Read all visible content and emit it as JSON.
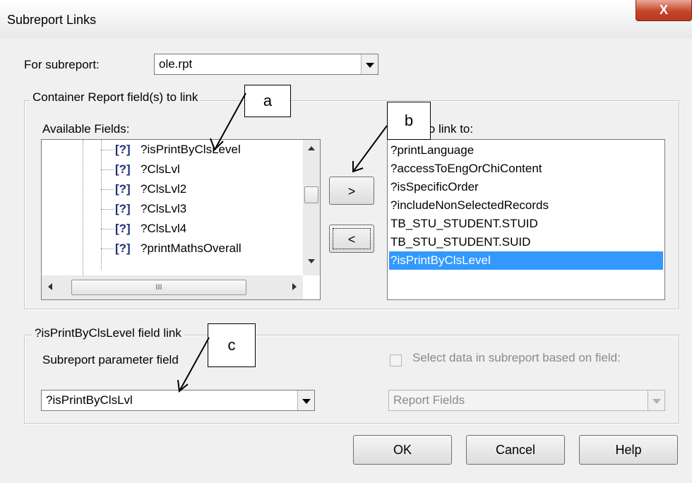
{
  "window": {
    "title": "Subreport Links",
    "close_label": "X"
  },
  "subreport": {
    "label": "For subreport:",
    "value": "ole.rpt"
  },
  "container_group": {
    "legend": "Container Report field(s) to link",
    "available_label": "Available Fields:",
    "available_fields": [
      "?isPrintByClsLevel",
      "?ClsLvl",
      "?ClsLvl2",
      "?ClsLvl3",
      "?ClsLvl4",
      "?printMathsOverall"
    ],
    "field_icon_text": "[?]",
    "hscroll_grip": "III",
    "add_button": ">",
    "remove_button": "<",
    "linked_label": "Fields to link to:",
    "linked_fields": [
      "?printLanguage",
      "?accessToEngOrChiContent",
      "?isSpecificOrder",
      "?includeNonSelectedRecords",
      "TB_STU_STUDENT.STUID",
      "TB_STU_STUDENT.SUID",
      "?isPrintByClsLevel"
    ],
    "linked_selected_index": 6
  },
  "field_link_group": {
    "legend": "?isPrintByClsLevel field link",
    "param_label": "Subreport parameter field",
    "param_value": "?isPrintByClsLvl",
    "select_data_label": "Select data in subreport based on field:",
    "report_fields_value": "Report Fields"
  },
  "buttons": {
    "ok": "OK",
    "cancel": "Cancel",
    "help": "Help"
  },
  "annotations": {
    "a": "a",
    "b": "b",
    "c": "c"
  },
  "colors": {
    "selection": "#3399ff",
    "close_button": "#c7442a",
    "field_icon": "#1c2f7a"
  }
}
